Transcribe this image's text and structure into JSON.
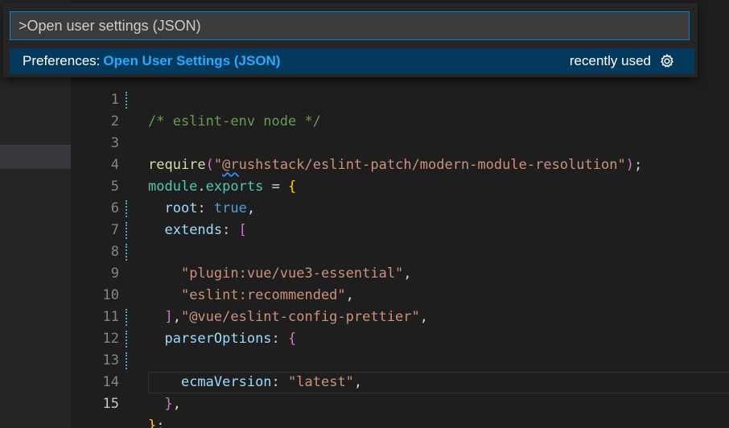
{
  "command_palette": {
    "input_value": ">Open user settings (JSON)",
    "selected_item": {
      "category": "Preferences:",
      "label": "Open User Settings (JSON)",
      "hint": "recently used",
      "icon": "gear-icon"
    }
  },
  "editor": {
    "active_line": 15,
    "lines": [
      {
        "number": "1",
        "text": "/* eslint-env node */"
      },
      {
        "number": "2",
        "text": "require(\"@rushstack/eslint-patch/modern-module-resolution\");"
      },
      {
        "number": "3",
        "text": ""
      },
      {
        "number": "4",
        "text": "module.exports = {"
      },
      {
        "number": "5",
        "text": "  root: true,"
      },
      {
        "number": "6",
        "text": "  extends: ["
      },
      {
        "number": "7",
        "text": "    \"plugin:vue/vue3-essential\","
      },
      {
        "number": "8",
        "text": "    \"eslint:recommended\","
      },
      {
        "number": "9",
        "text": "    \"@vue/eslint-config-prettier\","
      },
      {
        "number": "10",
        "text": "  ],"
      },
      {
        "number": "11",
        "text": "  parserOptions: {"
      },
      {
        "number": "12",
        "text": "    ecmaVersion: \"latest\","
      },
      {
        "number": "13",
        "text": "  },"
      },
      {
        "number": "14",
        "text": "};"
      },
      {
        "number": "15",
        "text": ""
      }
    ]
  },
  "colors": {
    "accent": "#007fd4",
    "selection": "#04395e",
    "highlight_label": "#2aaaff"
  }
}
